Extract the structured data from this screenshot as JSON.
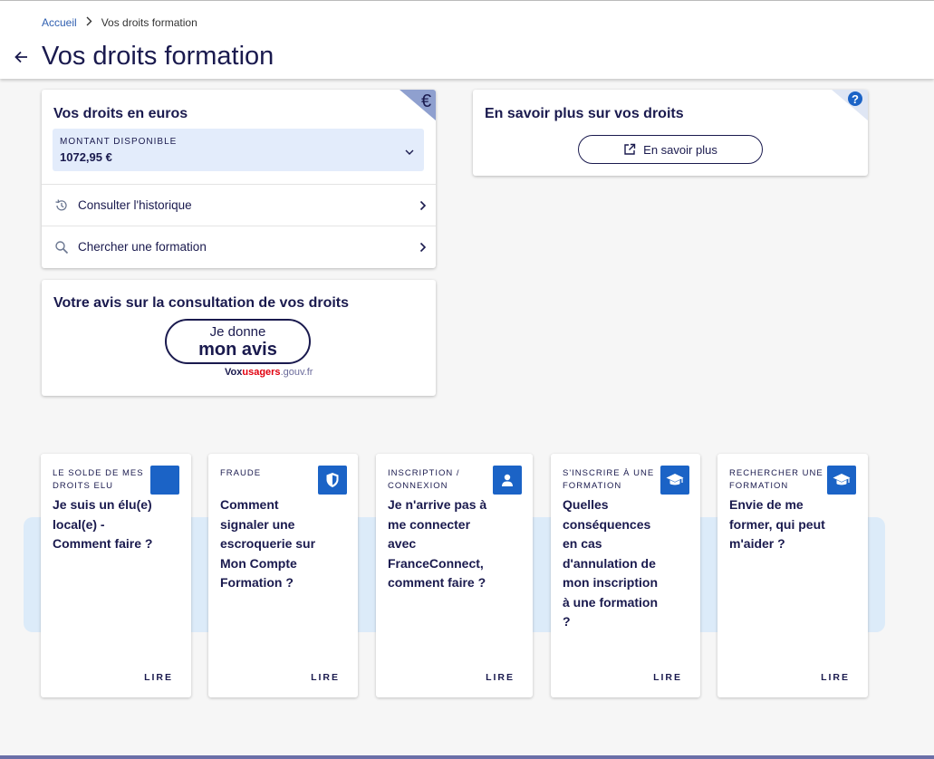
{
  "breadcrumb": {
    "home": "Accueil",
    "current": "Vos droits formation"
  },
  "page_title": "Vos droits formation",
  "droits": {
    "title": "Vos droits en euros",
    "montant_label": "MONTANT DISPONIBLE",
    "montant_value": "1072,95 €",
    "corner_symbol": "€",
    "rows": [
      {
        "label": "Consulter l'historique",
        "icon": "history-icon"
      },
      {
        "label": "Chercher une formation",
        "icon": "search-icon"
      }
    ]
  },
  "savoir": {
    "title": "En savoir plus sur vos droits",
    "button_label": "En savoir plus",
    "corner_symbol": "?"
  },
  "avis": {
    "title": "Votre avis sur la consultation de vos droits",
    "button_line1": "Je donne",
    "button_line2": "mon avis",
    "vox_part1": "Vox",
    "vox_part2": "usagers",
    "vox_part3": ".gouv.fr"
  },
  "faq": [
    {
      "category": "LE SOLDE DE MES DROITS ELU",
      "question": "Je suis un élu(e) local(e) - Comment faire ?",
      "link": "LIRE",
      "icon": "blank-icon"
    },
    {
      "category": "FRAUDE",
      "question": "Comment signaler une escroquerie sur Mon Compte Formation ?",
      "link": "LIRE",
      "icon": "shield-icon"
    },
    {
      "category": "INSCRIPTION / CONNEXION",
      "question": "Je n'arrive pas à me connecter avec FranceConnect, comment faire ?",
      "link": "LIRE",
      "icon": "user-icon"
    },
    {
      "category": "S'INSCRIRE À UNE FORMATION",
      "question": "Quelles conséquences en cas d'annulation de mon inscription à une formation ?",
      "link": "LIRE",
      "icon": "graduation-cap-icon"
    },
    {
      "category": "RECHERCHER UNE FORMATION",
      "question": "Envie de me former, qui peut m'aider ?",
      "link": "LIRE",
      "icon": "graduation-cap-icon"
    }
  ],
  "colors": {
    "navy": "#1a1a4e",
    "blue": "#1b63c6",
    "light_blue": "#e3ecfb",
    "red": "#e1000f"
  }
}
